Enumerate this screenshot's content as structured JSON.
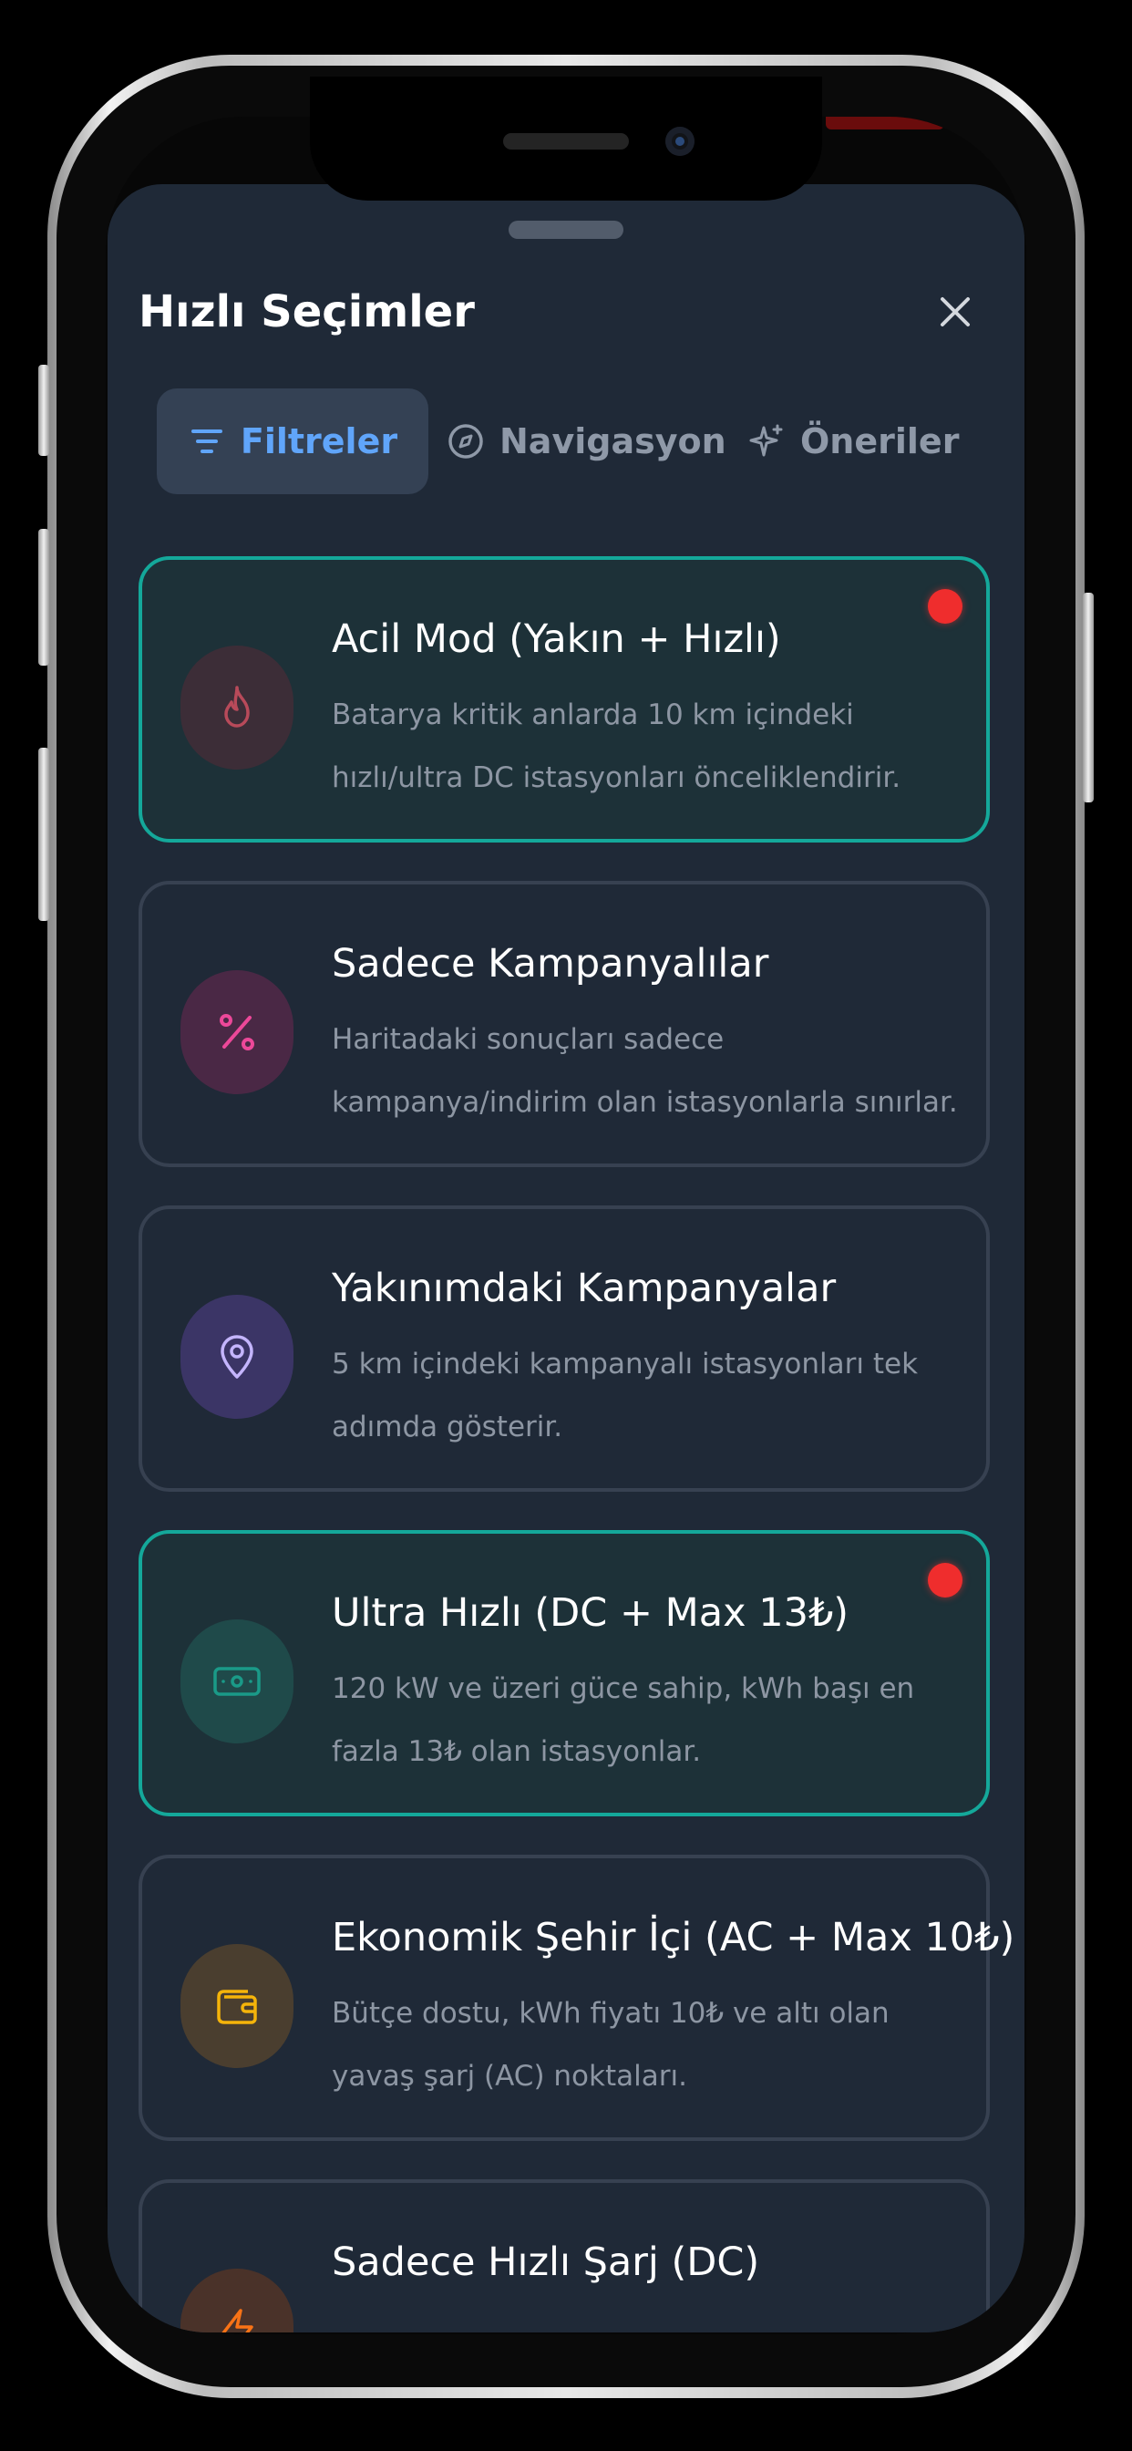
{
  "sheet": {
    "title": "Hızlı Seçimler"
  },
  "tabs": [
    {
      "label": "Filtreler",
      "icon": "filter-icon",
      "active": true
    },
    {
      "label": "Navigasyon",
      "icon": "compass-icon",
      "active": false
    },
    {
      "label": "Öneriler",
      "icon": "sparkles-icon",
      "active": false
    }
  ],
  "cards": [
    {
      "title": "Acil Mod (Yakın + Hızlı)",
      "desc": "Batarya kritik anlarda 10 km içindeki hızlı/ultra DC istasyonları önceliklendirir.",
      "icon": "flame-icon",
      "selected": true,
      "icon_color": "#b84a5a"
    },
    {
      "title": "Sadece Kampanyalılar",
      "desc": "Haritadaki sonuçları sadece kampanya/indirim olan istasyonlarla sınırlar.",
      "icon": "percent-icon",
      "selected": false,
      "icon_color": "#ec4899"
    },
    {
      "title": "Yakınımdaki Kampanyalar",
      "desc": "5 km içindeki kampanyalı istasyonları tek adımda gösterir.",
      "icon": "map-pin-icon",
      "selected": false,
      "icon_color": "#c4b5fd"
    },
    {
      "title": "Ultra Hızlı (DC + Max 13₺)",
      "desc": "120 kW ve üzeri güce sahip, kWh başı en fazla 13₺ olan istasyonlar.",
      "icon": "banknote-icon",
      "selected": true,
      "icon_color": "#1a9a88"
    },
    {
      "title": "Ekonomik Şehir İçi (AC + Max 10₺)",
      "desc": "Bütçe dostu, kWh fiyatı 10₺ ve altı olan yavaş şarj (AC) noktaları.",
      "icon": "wallet-icon",
      "selected": false,
      "icon_color": "#f5b40a"
    },
    {
      "title": "Sadece Hızlı Şarj (DC)",
      "desc": "",
      "icon": "zap-icon",
      "selected": false,
      "icon_color": "#f97316"
    }
  ],
  "colors": {
    "sheet_bg": "#1f2937",
    "accent_teal": "#14a89a",
    "active_tab_text": "#60a5fa",
    "indicator_red": "#ef2d2d"
  }
}
